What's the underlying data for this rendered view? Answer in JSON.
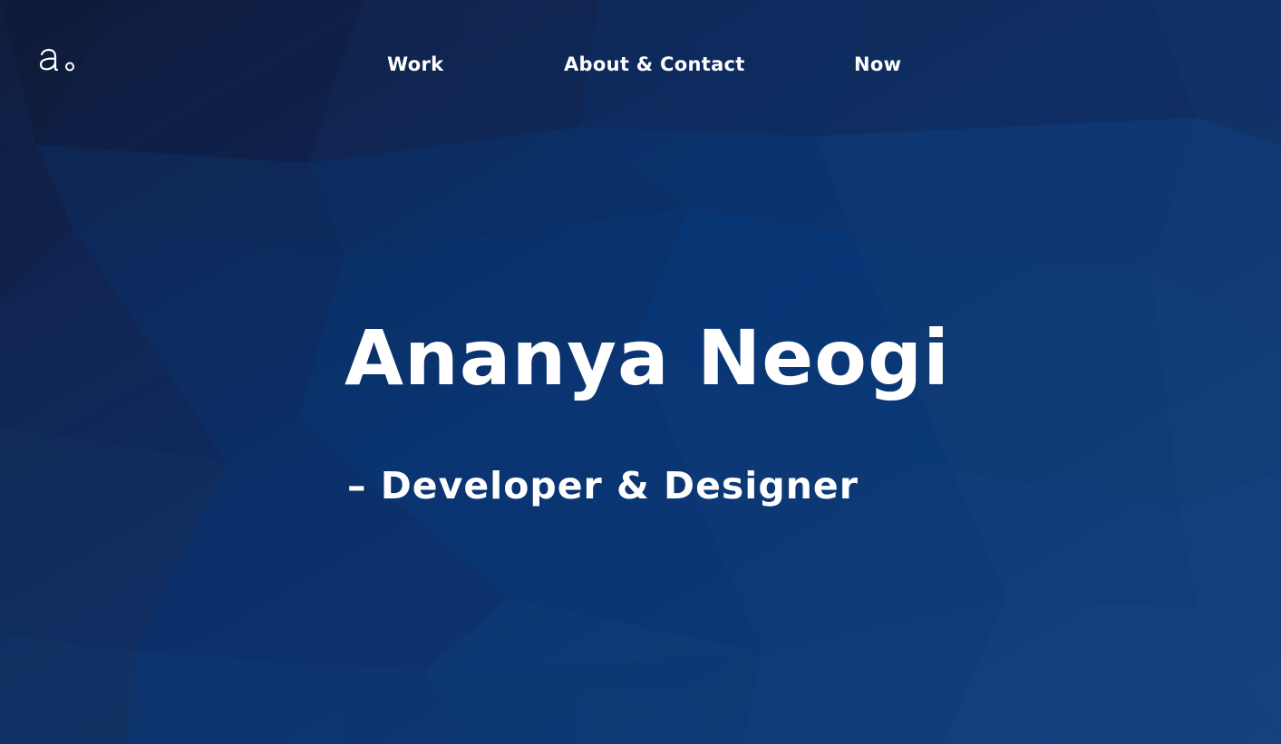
{
  "colors": {
    "background_dark": "#0f1f47",
    "background_mid": "#0b3370",
    "background_light": "#14427f",
    "text": "#ffffff"
  },
  "header": {
    "logo_icon": "a-circle-logo-icon",
    "nav": [
      {
        "label": "Work"
      },
      {
        "label": "About & Contact"
      },
      {
        "label": "Now"
      }
    ]
  },
  "hero": {
    "name": "Ananya Neogi",
    "tagline": "– Developer & Designer"
  }
}
